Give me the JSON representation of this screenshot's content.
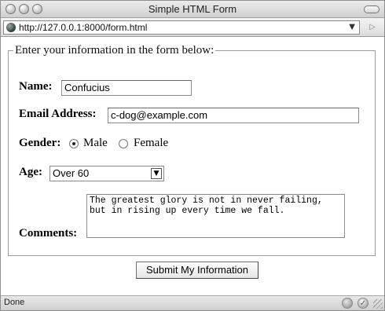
{
  "window": {
    "title": "Simple HTML Form"
  },
  "address_bar": {
    "url": "http://127.0.0.1:8000/form.html",
    "dropdown_icon": "chevron-down-icon",
    "go_icon": "play-icon"
  },
  "form": {
    "legend": "Enter your information in the form below:",
    "name": {
      "label": "Name:",
      "value": "Confucius"
    },
    "email": {
      "label": "Email Address:",
      "value": "c-dog@example.com"
    },
    "gender": {
      "label": "Gender:",
      "options": [
        "Male",
        "Female"
      ],
      "selected": "Male"
    },
    "age": {
      "label": "Age:",
      "selected": "Over 60"
    },
    "comments": {
      "label": "Comments:",
      "value": "The greatest glory is not in never failing, but in rising up every time we fall."
    },
    "submit_label": "Submit My Information"
  },
  "status": {
    "text": "Done"
  }
}
